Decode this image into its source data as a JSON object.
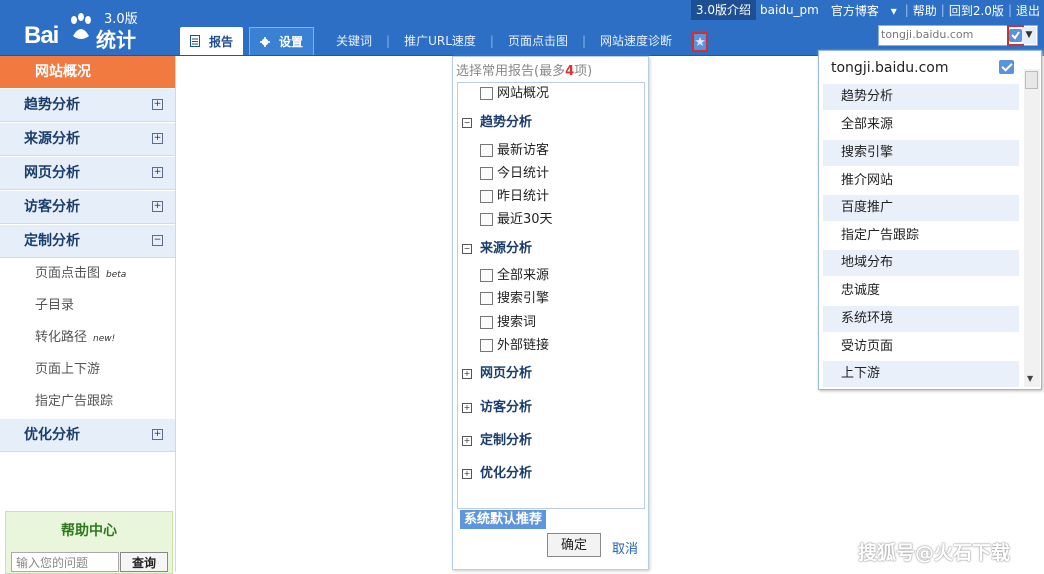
{
  "brand": {
    "logo_text": "Bai",
    "logo_suffix": "统计",
    "version": "3.0版"
  },
  "top_links": {
    "intro": "3.0版介绍",
    "user": "baidu_pm",
    "blog": "官方博客",
    "help": "帮助",
    "back": "回到2.0版",
    "logout": "退出"
  },
  "tabs": {
    "report": "报告",
    "settings": "设置",
    "links": [
      "关键词",
      "推广URL速度",
      "页面点击图",
      "网站速度诊断"
    ]
  },
  "site_selector": {
    "value": "tongji.baidu.com"
  },
  "sidebar": {
    "overview": "网站概况",
    "groups": [
      {
        "label": "趋势分析",
        "toggle": "+"
      },
      {
        "label": "来源分析",
        "toggle": "+"
      },
      {
        "label": "网页分析",
        "toggle": "+"
      },
      {
        "label": "访客分析",
        "toggle": "+"
      },
      {
        "label": "定制分析",
        "toggle": "−"
      }
    ],
    "sub_items": [
      {
        "label": "页面点击图",
        "tag": "beta"
      },
      {
        "label": "子目录",
        "tag": ""
      },
      {
        "label": "转化路径",
        "tag": "new!"
      },
      {
        "label": "页面上下游",
        "tag": ""
      },
      {
        "label": "指定广告跟踪",
        "tag": ""
      }
    ],
    "optimize": {
      "label": "优化分析",
      "toggle": "+"
    }
  },
  "help": {
    "title": "帮助中心",
    "placeholder": "输入您的问题",
    "button": "查询"
  },
  "report_popup": {
    "title_prefix": "选择常用报告(最多",
    "max": "4",
    "title_suffix": "项)",
    "rows": [
      {
        "type": "item",
        "label": "网站概况"
      },
      {
        "type": "group",
        "toggle": "−",
        "label": "趋势分析"
      },
      {
        "type": "item",
        "label": "最新访客"
      },
      {
        "type": "item",
        "label": "今日统计"
      },
      {
        "type": "item",
        "label": "昨日统计"
      },
      {
        "type": "item",
        "label": "最近30天"
      },
      {
        "type": "group",
        "toggle": "−",
        "label": "来源分析"
      },
      {
        "type": "item",
        "label": "全部来源"
      },
      {
        "type": "item",
        "label": "搜索引擎"
      },
      {
        "type": "item",
        "label": "搜索词"
      },
      {
        "type": "item",
        "label": "外部链接"
      },
      {
        "type": "group",
        "toggle": "+",
        "label": "网页分析"
      },
      {
        "type": "group",
        "toggle": "+",
        "label": "访客分析"
      },
      {
        "type": "group",
        "toggle": "+",
        "label": "定制分析"
      },
      {
        "type": "group",
        "toggle": "+",
        "label": "优化分析"
      }
    ],
    "default_button": "系统默认推荐",
    "ok": "确定",
    "cancel": "取消"
  },
  "site_dropdown": {
    "header": "tongji.baidu.com",
    "items": [
      "趋势分析",
      "全部来源",
      "搜索引擎",
      "推介网站",
      "百度推广",
      "指定广告跟踪",
      "地域分布",
      "忠诚度",
      "系统环境",
      "受访页面",
      "上下游"
    ]
  },
  "watermark": "搜狐号@火石下载",
  "colors": {
    "topbar": "#2d6fc4",
    "overview": "#f07a40",
    "highlight": "#d03030"
  }
}
